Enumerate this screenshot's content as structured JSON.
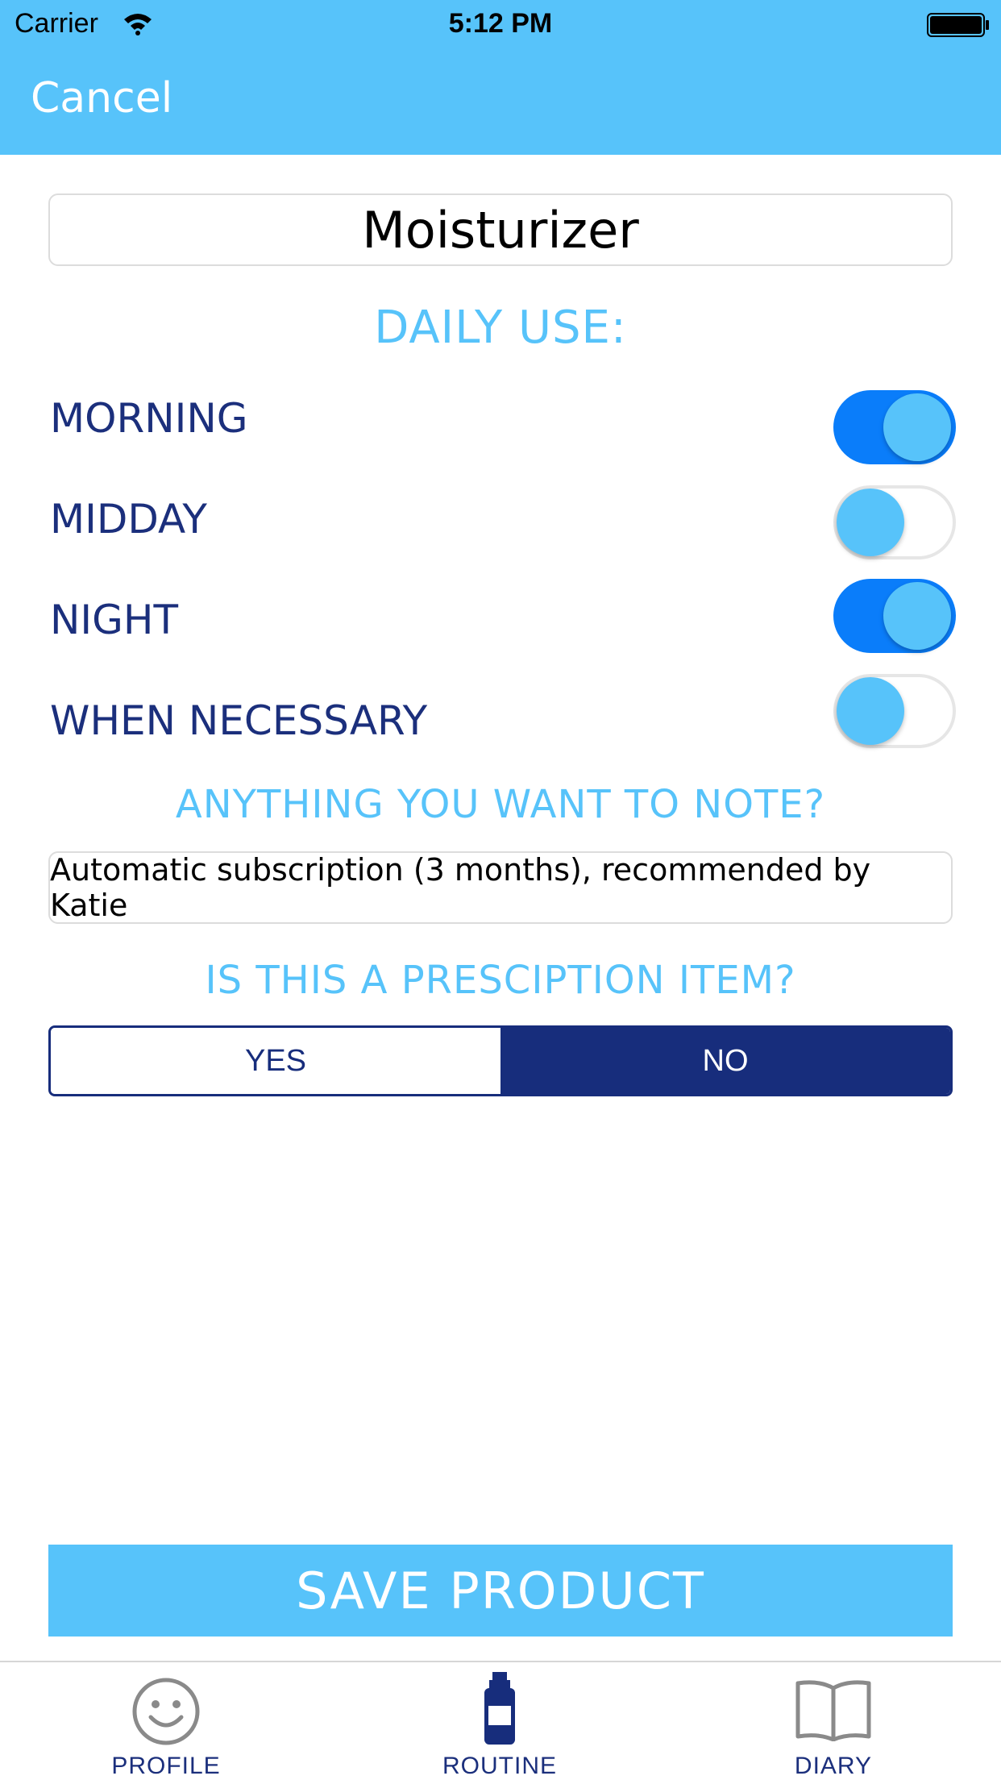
{
  "status_bar": {
    "carrier": "Carrier",
    "time": "5:12 PM"
  },
  "header": {
    "cancel_label": "Cancel"
  },
  "product": {
    "name": "Moisturizer"
  },
  "daily_use": {
    "title": "DAILY USE:",
    "options": [
      {
        "label": "MORNING",
        "enabled": true
      },
      {
        "label": "MIDDAY",
        "enabled": false
      },
      {
        "label": "NIGHT",
        "enabled": true
      },
      {
        "label": "WHEN NECESSARY",
        "enabled": false
      }
    ]
  },
  "note": {
    "title": "ANYTHING YOU WANT TO NOTE?",
    "value": "Automatic subscription (3 months), recommended by Katie"
  },
  "prescription": {
    "title": "IS THIS A PRESCIPTION ITEM?",
    "options": [
      "YES",
      "NO"
    ],
    "selected": "NO"
  },
  "save_label": "SAVE PRODUCT",
  "tab_bar": {
    "items": [
      {
        "label": "PROFILE",
        "icon": "smiley-face-icon"
      },
      {
        "label": "ROUTINE",
        "icon": "bottle-icon"
      },
      {
        "label": "DIARY",
        "icon": "open-book-icon"
      }
    ]
  },
  "colors": {
    "accent_light_blue": "#57c3fa",
    "navy": "#172d7c",
    "toggle_on": "#0a7dfa"
  }
}
